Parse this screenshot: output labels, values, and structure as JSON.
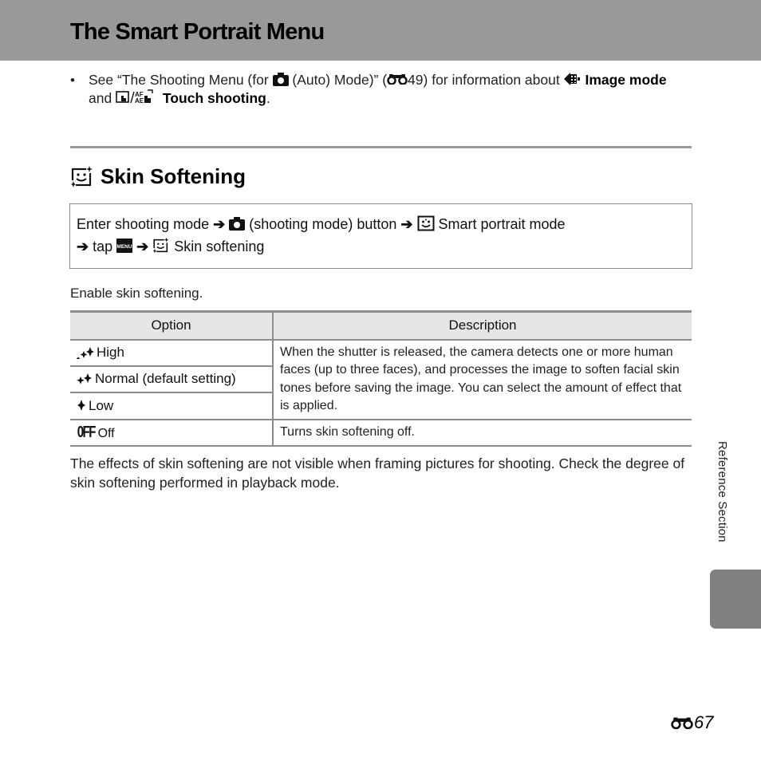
{
  "header": {
    "title": "The Smart Portrait Menu"
  },
  "bullet": {
    "dot": "•",
    "part1": "See “The Shooting Menu (for ",
    "icon_camera": "camera-icon",
    "part2": " (Auto) Mode)” (",
    "icon_ref": "binoculars-reference-icon",
    "ref_page": "49",
    "part3": ") for information about ",
    "icon_image_mode": "image-mode-icon",
    "image_mode_label": "Image mode",
    "part4": " and ",
    "icon_touch": "touch-shooting-icon",
    "touch_label": "Touch shooting",
    "end": "."
  },
  "section": {
    "icon": "skin-softening-icon",
    "title": "Skin Softening"
  },
  "path": {
    "step1": "Enter shooting mode",
    "arrow": "➔",
    "step2": "(shooting mode) button",
    "step3": "Smart portrait mode",
    "step4": "tap",
    "step5": "Skin softening",
    "icons": [
      "camera-icon",
      "smart-portrait-icon",
      "menu-icon",
      "skin-softening-icon"
    ]
  },
  "intro": "Enable skin softening.",
  "table": {
    "headers": [
      "Option",
      "Description"
    ],
    "rows": [
      {
        "icon": "high-icon",
        "option": "High"
      },
      {
        "icon": "normal-icon",
        "option": "Normal (default setting)"
      },
      {
        "icon": "low-icon",
        "option": "Low"
      },
      {
        "icon": "off-icon",
        "icon_text": "0FF",
        "option": "Off",
        "description": "Turns skin softening off."
      }
    ],
    "shared_description": "When the shutter is released, the camera detects one or more human faces (up to three faces), and processes the image to soften facial skin tones before saving the image. You can select the amount of effect that is applied."
  },
  "note": "The effects of skin softening are not visible when framing pictures for shooting. Check the degree of skin softening performed in playback mode.",
  "sidebar": {
    "label": "Reference Section",
    "tab_color": "#808080"
  },
  "footer": {
    "page_icon": "binoculars-reference-icon",
    "page_number": "67"
  },
  "colors": {
    "header_band": "#999999",
    "rule": "#999999",
    "table_header_bg": "#e6e6e6",
    "table_border": "#8c8c8c"
  }
}
